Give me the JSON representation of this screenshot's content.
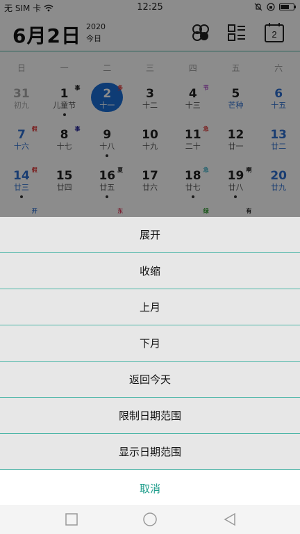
{
  "status": {
    "carrier": "无 SIM 卡",
    "time": "12:25",
    "battery_level": 0.65
  },
  "header": {
    "date": "6月2日",
    "year": "2020",
    "today": "今日",
    "icon_cal_num": "2"
  },
  "weekdays": [
    "日",
    "一",
    "二",
    "三",
    "四",
    "五",
    "六"
  ],
  "weeks": [
    [
      {
        "num": "31",
        "lunar": "初九",
        "dim": true
      },
      {
        "num": "1",
        "lunar": "儿童节",
        "mark": "事",
        "markColor": "#222",
        "dot": true
      },
      {
        "num": "2",
        "lunar": "十一",
        "mark": "多",
        "markColor": "#d33",
        "sel": true
      },
      {
        "num": "3",
        "lunar": "十二"
      },
      {
        "num": "4",
        "lunar": "十三",
        "mark": "节",
        "markColor": "#a43cc4"
      },
      {
        "num": "5",
        "lunar": "芒种",
        "lunarColor": "#2f6fd0"
      },
      {
        "num": "6",
        "lunar": "十五",
        "weekend": true
      }
    ],
    [
      {
        "num": "7",
        "lunar": "十六",
        "weekend": true,
        "mark": "假",
        "markColor": "#d33"
      },
      {
        "num": "8",
        "lunar": "十七",
        "mark": "事",
        "markColor": "#2a2a9a"
      },
      {
        "num": "9",
        "lunar": "十八",
        "dot": true
      },
      {
        "num": "10",
        "lunar": "十九"
      },
      {
        "num": "11",
        "lunar": "二十",
        "mark": "急",
        "markColor": "#d33"
      },
      {
        "num": "12",
        "lunar": "廿一"
      },
      {
        "num": "13",
        "lunar": "廿二",
        "weekend": true
      }
    ],
    [
      {
        "num": "14",
        "lunar": "廿三",
        "weekend": true,
        "mark": "假",
        "markColor": "#d33",
        "dot": true
      },
      {
        "num": "15",
        "lunar": "廿四"
      },
      {
        "num": "16",
        "lunar": "廿五",
        "mark": "夏",
        "markColor": "#222",
        "dot": true
      },
      {
        "num": "17",
        "lunar": "廿六"
      },
      {
        "num": "18",
        "lunar": "廿七",
        "mark": "急",
        "markColor": "#3bb1c8",
        "dot": true
      },
      {
        "num": "19",
        "lunar": "廿八",
        "mark": "啊",
        "markColor": "#222",
        "dot": true
      },
      {
        "num": "20",
        "lunar": "廿九",
        "weekend": true
      }
    ],
    [
      {
        "num": "",
        "lunar": "",
        "mark": "开",
        "markColor": "#2f6fd0"
      },
      {
        "num": "",
        "lunar": ""
      },
      {
        "num": "",
        "lunar": "",
        "mark": "东",
        "markColor": "#d35"
      },
      {
        "num": "",
        "lunar": ""
      },
      {
        "num": "",
        "lunar": "",
        "mark": "绿",
        "markColor": "#2a9a2a"
      },
      {
        "num": "",
        "lunar": "",
        "mark": "有",
        "markColor": "#222"
      },
      {
        "num": "",
        "lunar": ""
      }
    ]
  ],
  "menu": {
    "expand": "展开",
    "collapse": "收缩",
    "prev_month": "上月",
    "next_month": "下月",
    "back_today": "返回今天",
    "limit_range": "限制日期范围",
    "show_range": "显示日期范围",
    "cancel": "取消"
  },
  "colors": {
    "accent": "#1c9c8a",
    "selected": "#1a6ed6",
    "weekend": "#2f6fd0"
  }
}
